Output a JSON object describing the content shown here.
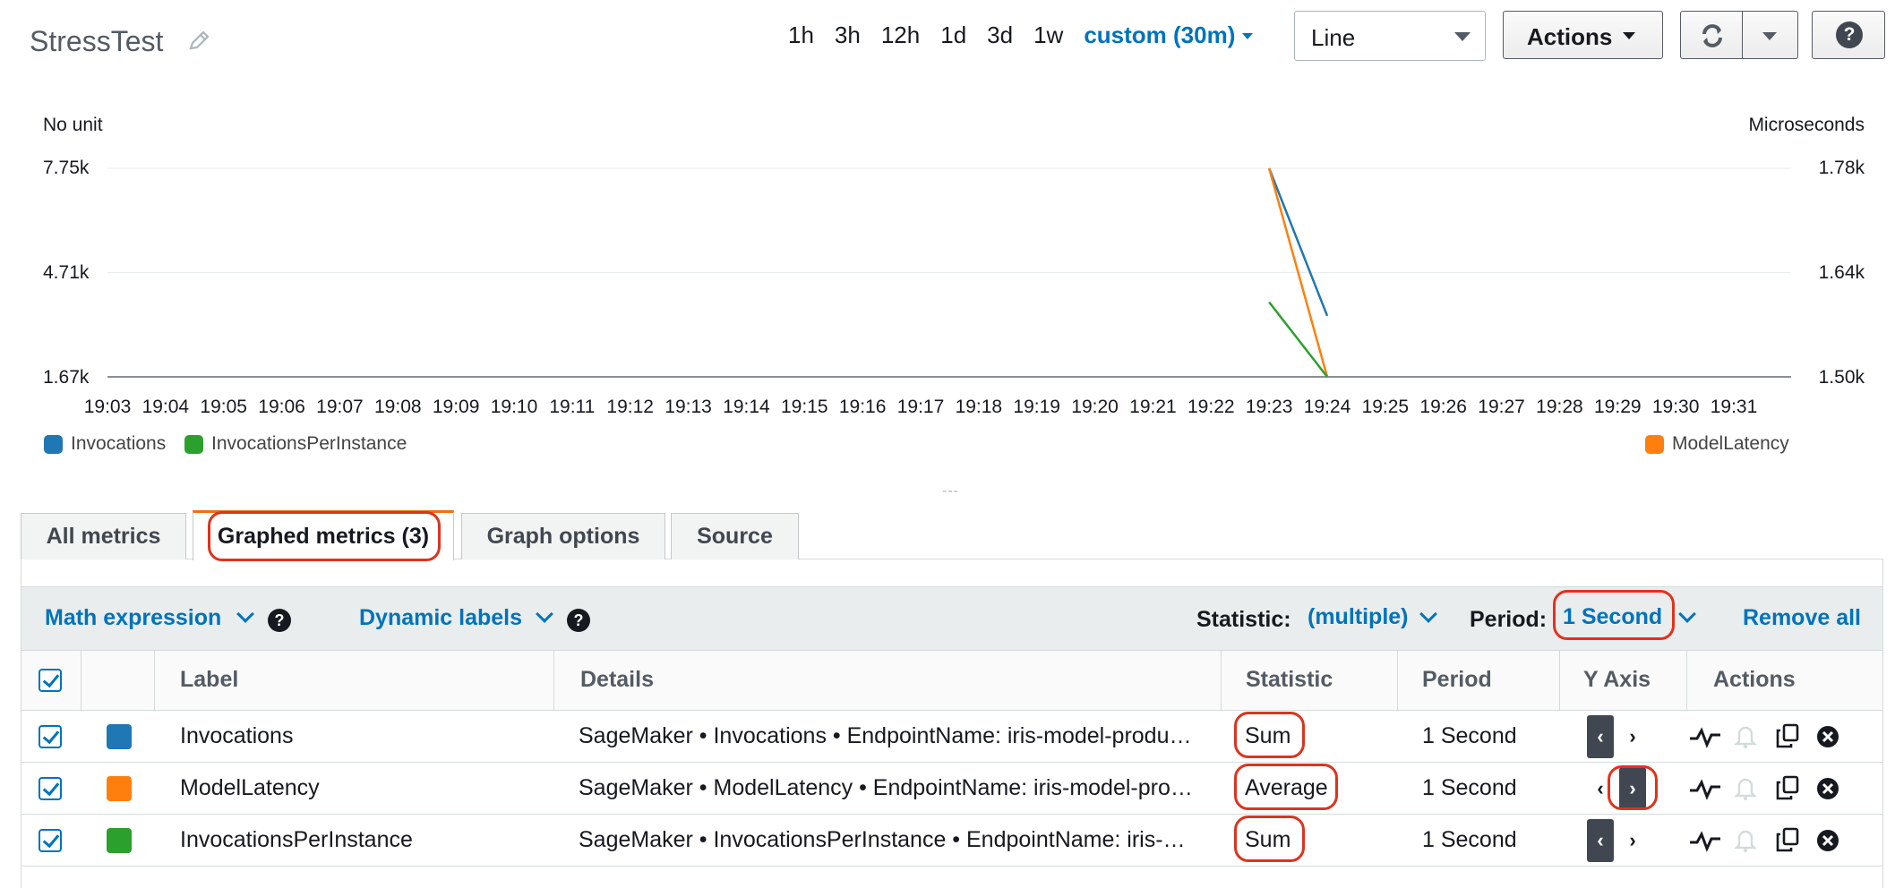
{
  "header": {
    "title": "StressTest",
    "time_ranges": [
      "1h",
      "3h",
      "12h",
      "1d",
      "3d",
      "1w"
    ],
    "custom_range": "custom (30m)",
    "graph_type": "Line",
    "actions_label": "Actions",
    "help_glyph": "?"
  },
  "chart_data": {
    "type": "line",
    "y_left_unit": "No unit",
    "y_right_unit": "Microseconds",
    "y_left_ticks": [
      "7.75k",
      "4.71k",
      "1.67k"
    ],
    "y_right_ticks": [
      "1.78k",
      "1.64k",
      "1.50k"
    ],
    "y_left_range": [
      1670,
      7750
    ],
    "y_right_range": [
      1500,
      1780
    ],
    "x_ticks": [
      "19:03",
      "19:04",
      "19:05",
      "19:06",
      "19:07",
      "19:08",
      "19:09",
      "19:10",
      "19:11",
      "19:12",
      "19:13",
      "19:14",
      "19:15",
      "19:16",
      "19:17",
      "19:18",
      "19:19",
      "19:20",
      "19:21",
      "19:22",
      "19:23",
      "19:24",
      "19:25",
      "19:26",
      "19:27",
      "19:28",
      "19:29",
      "19:30",
      "19:31"
    ],
    "series": [
      {
        "name": "Invocations",
        "axis": "left",
        "color": "#1f77b4",
        "x": [
          "19:23",
          "19:24"
        ],
        "y": [
          7750,
          3450
        ]
      },
      {
        "name": "ModelLatency",
        "axis": "right",
        "color": "#ff7f0e",
        "x": [
          "19:23",
          "19:24"
        ],
        "y": [
          1780,
          1500
        ]
      },
      {
        "name": "InvocationsPerInstance",
        "axis": "left",
        "color": "#2ca02c",
        "x": [
          "19:23",
          "19:24"
        ],
        "y": [
          3850,
          1670
        ]
      }
    ],
    "legend_left": [
      "Invocations",
      "InvocationsPerInstance"
    ],
    "legend_right": [
      "ModelLatency"
    ],
    "grid": true
  },
  "tabs": [
    {
      "label": "All metrics",
      "active": false
    },
    {
      "label": "Graphed metrics (3)",
      "active": true
    },
    {
      "label": "Graph options",
      "active": false
    },
    {
      "label": "Source",
      "active": false
    }
  ],
  "toolbar": {
    "math_expression": "Math expression",
    "dynamic_labels": "Dynamic labels",
    "statistic_label": "Statistic:",
    "statistic_value": "(multiple)",
    "period_label": "Period:",
    "period_value": "1 Second",
    "remove_all": "Remove all"
  },
  "table": {
    "columns": [
      "Label",
      "Details",
      "Statistic",
      "Period",
      "Y Axis",
      "Actions"
    ],
    "rows": [
      {
        "label": "Invocations",
        "color": "#1f77b4",
        "details": "SageMaker • Invocations • EndpointName: iris-model-produ…",
        "statistic": "Sum",
        "period": "1 Second",
        "y_axis": "left"
      },
      {
        "label": "ModelLatency",
        "color": "#ff7f0e",
        "details": "SageMaker • ModelLatency • EndpointName: iris-model-pro…",
        "statistic": "Average",
        "period": "1 Second",
        "y_axis": "right"
      },
      {
        "label": "InvocationsPerInstance",
        "color": "#2ca02c",
        "details": "SageMaker • InvocationsPerInstance • EndpointName: iris-…",
        "statistic": "Sum",
        "period": "1 Second",
        "y_axis": "left"
      }
    ],
    "row_icons": [
      "graph-metric-icon",
      "alarm-bell-icon",
      "duplicate-icon",
      "remove-icon"
    ]
  },
  "colors": {
    "accent_blue": "#0073bb",
    "tab_active_top": "#ec7211",
    "highlight_red": "#e0321e"
  }
}
